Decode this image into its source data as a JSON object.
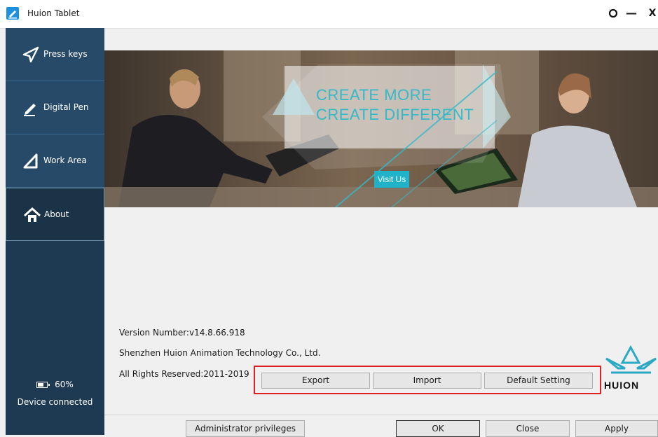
{
  "window": {
    "title": "Huion Tablet",
    "controls": {
      "settings": "⚙",
      "minimize": "—",
      "close": "X"
    }
  },
  "sidebar": {
    "items": [
      {
        "label": "Press keys",
        "icon": "send-icon",
        "active": false
      },
      {
        "label": "Digital Pen",
        "icon": "pen-icon",
        "active": false
      },
      {
        "label": "Work Area",
        "icon": "triangle-icon",
        "active": false
      },
      {
        "label": "About",
        "icon": "home-icon",
        "active": true
      }
    ],
    "battery_level": "60%",
    "device_status": "Device connected"
  },
  "banner": {
    "line1": "CREATE MORE",
    "line2": "CREATE DIFFERENT",
    "visit_button": "Visit Us"
  },
  "about": {
    "version": "Version Number:v14.8.66.918",
    "company": "Shenzhen Huion Animation Technology Co., Ltd.",
    "rights": "All Rights Reserved:2011-2019"
  },
  "actions": {
    "export": "Export",
    "import": "Import",
    "default_setting": "Default Setting"
  },
  "logo": {
    "text": "HUION"
  },
  "footer": {
    "admin": "Administrator privileges",
    "ok": "OK",
    "close": "Close",
    "apply": "Apply"
  },
  "colors": {
    "sidebar_bg": "#1d3a52",
    "sidebar_item": "#274a68",
    "accent": "#35b9c9",
    "highlight_border": "#e02020"
  }
}
